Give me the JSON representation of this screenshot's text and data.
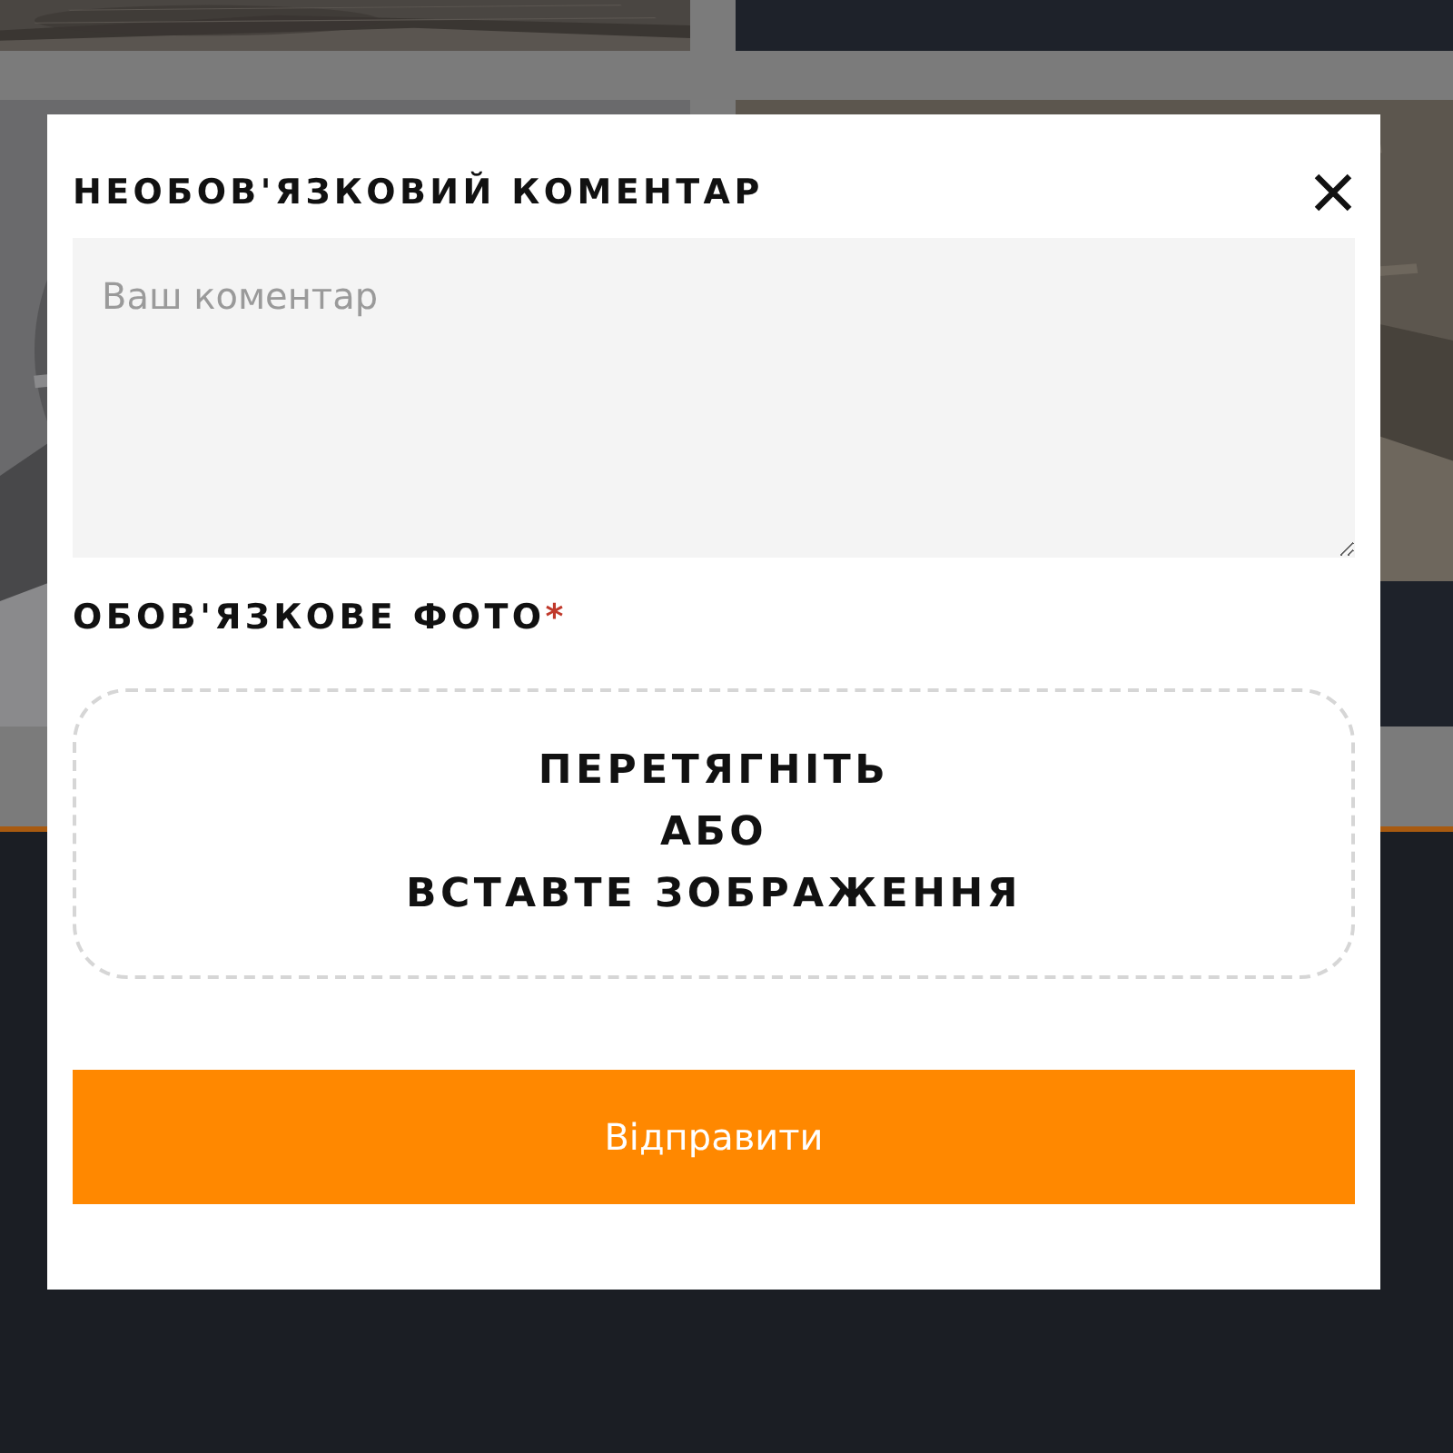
{
  "modal": {
    "comment_label": "НЕОБОВ'ЯЗКОВИЙ КОМЕНТАР",
    "comment_field": {
      "placeholder": "Ваш коментар"
    },
    "photo_label": {
      "text": "ОБОВ'ЯЗКОВЕ ФОТО",
      "required_mark": "*"
    },
    "dropzone": {
      "lines": [
        "ПЕРЕТЯГНІТЬ",
        "АБО",
        "ВСТАВТЕ ЗОБРАЖЕННЯ"
      ]
    },
    "submit": "Відправити"
  }
}
